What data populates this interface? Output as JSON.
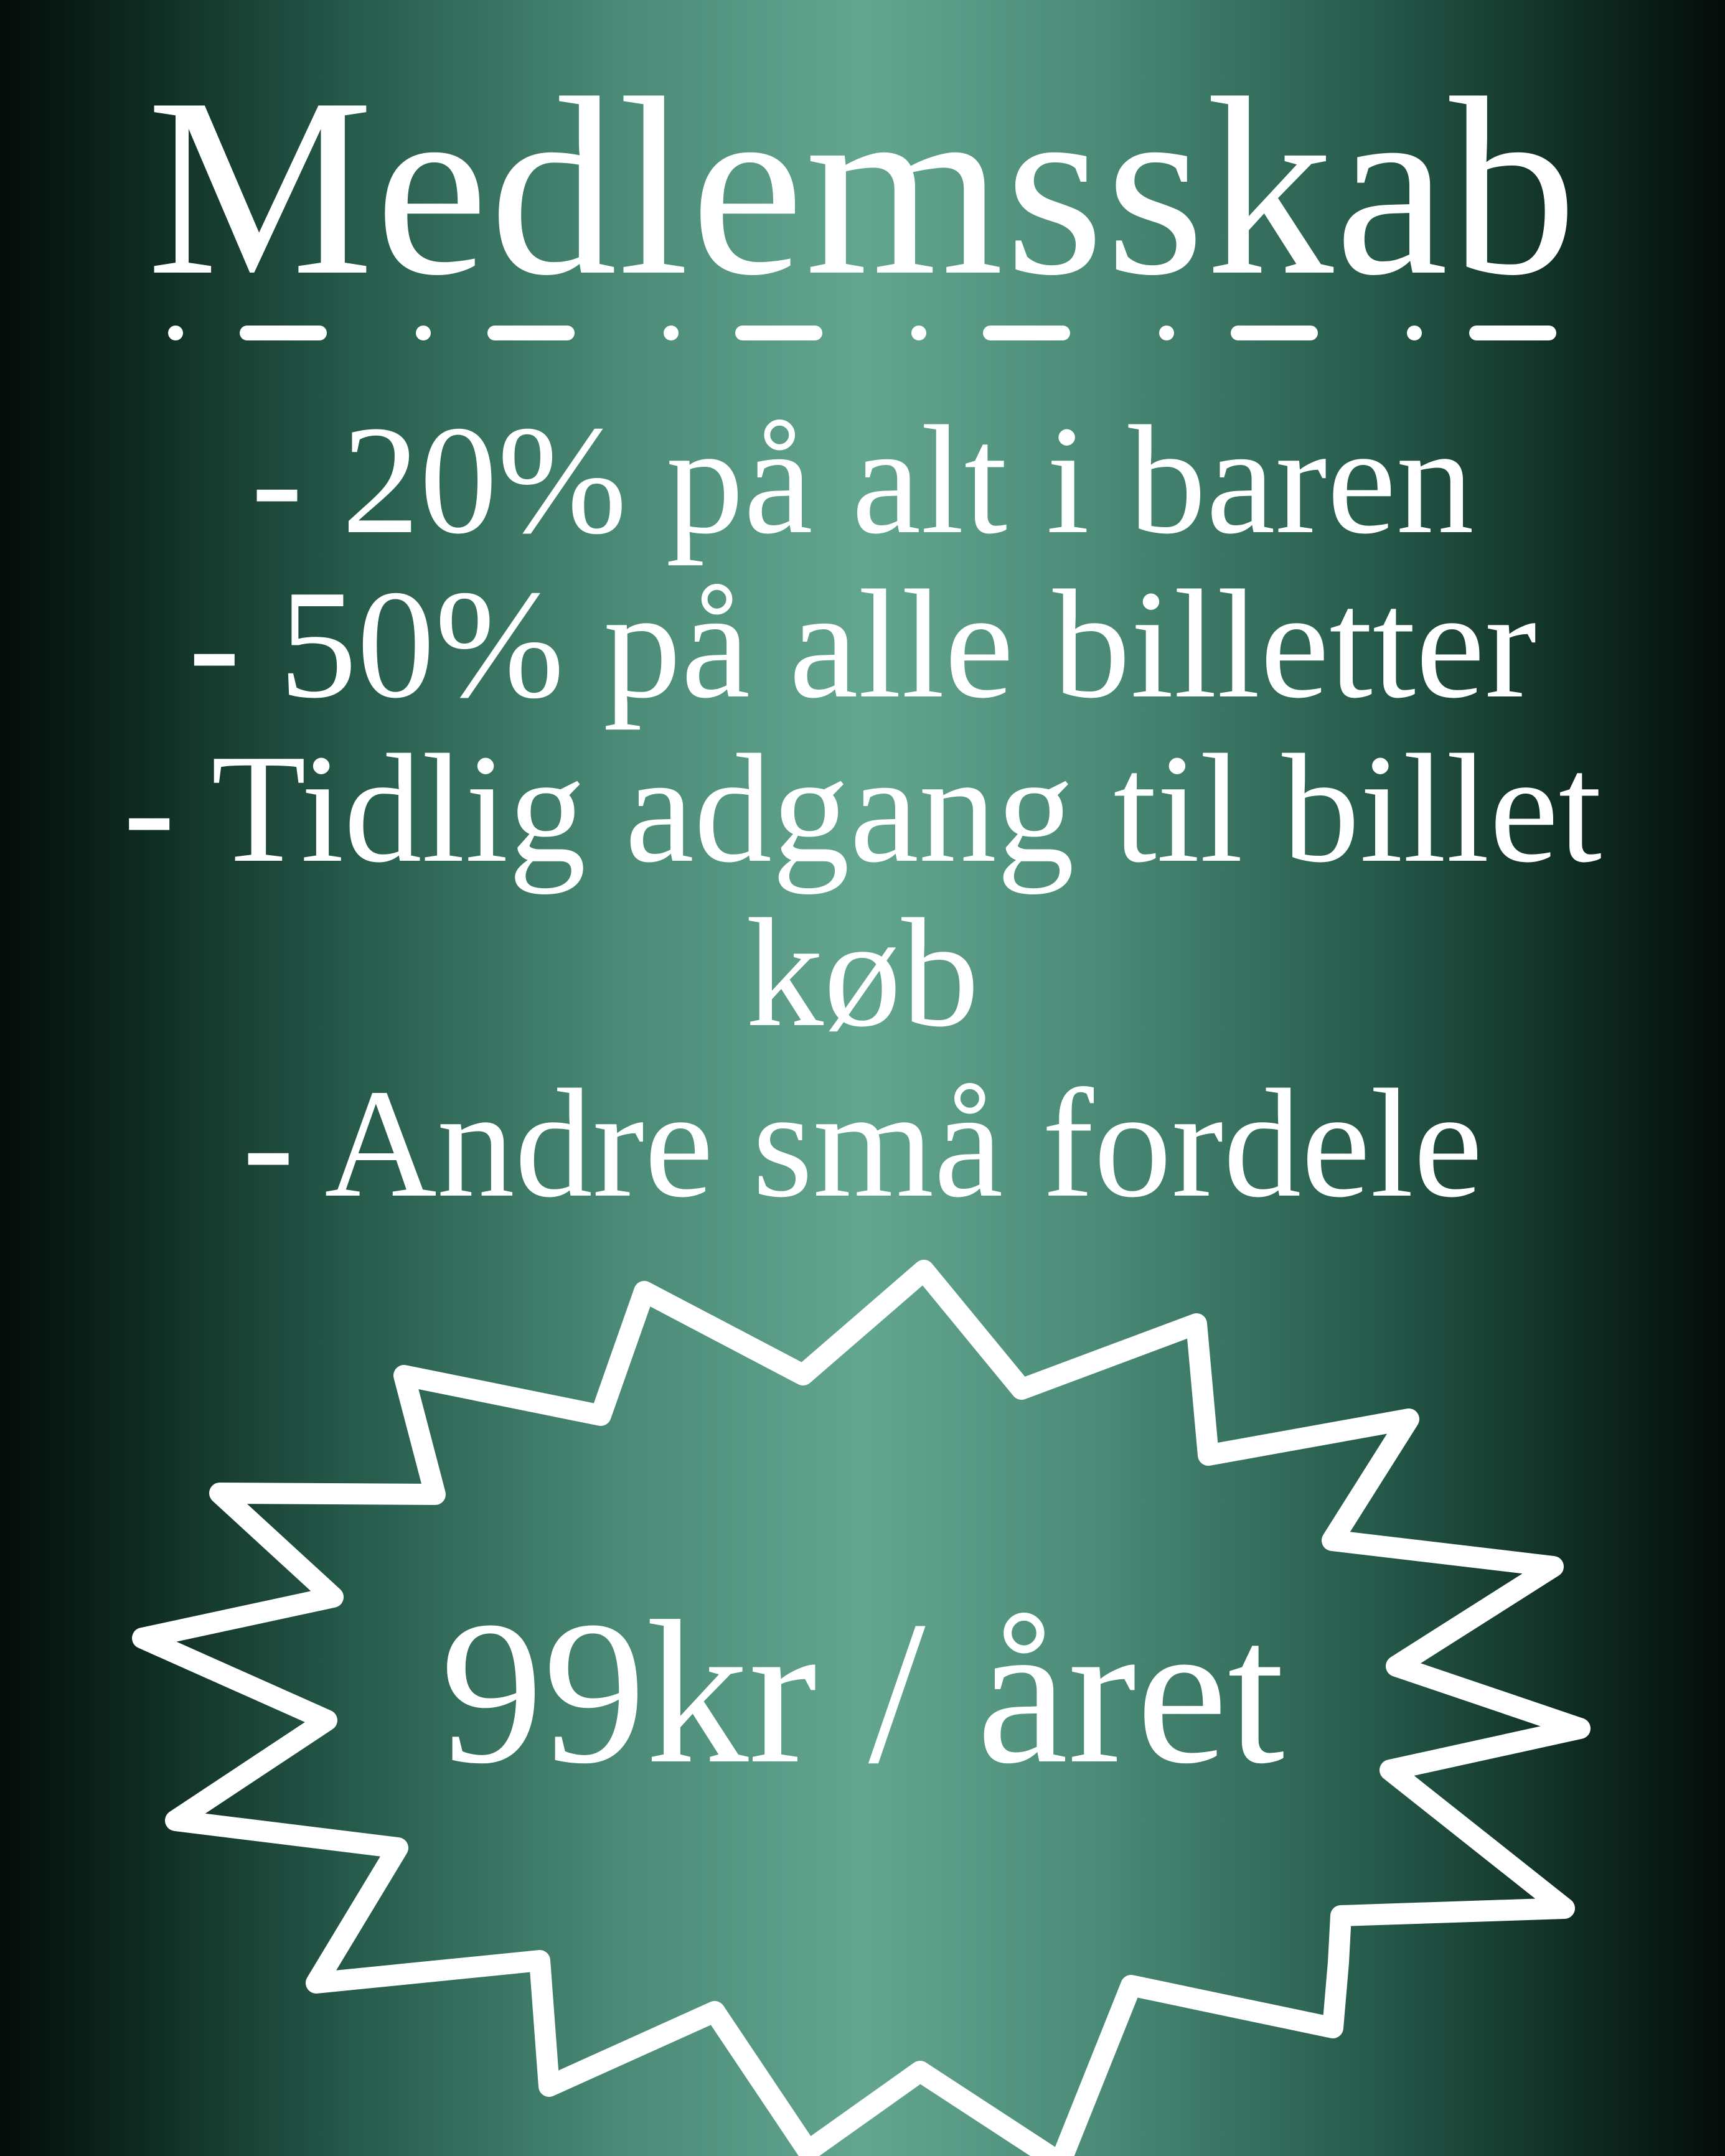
{
  "poster": {
    "title": "Medlemsskab",
    "benefits": [
      "- 20% på alt i baren",
      "- 50% på alle billetter",
      "- Tidlig adgang til billet køb",
      "- Andre små fordele"
    ],
    "price": "99kr / året"
  },
  "colors": {
    "text": "#ffffff",
    "background_center": "#63a690",
    "background_edge": "#040c09"
  },
  "icons": {
    "divider": "dot-dash-divider",
    "price_badge": "starburst-badge"
  }
}
